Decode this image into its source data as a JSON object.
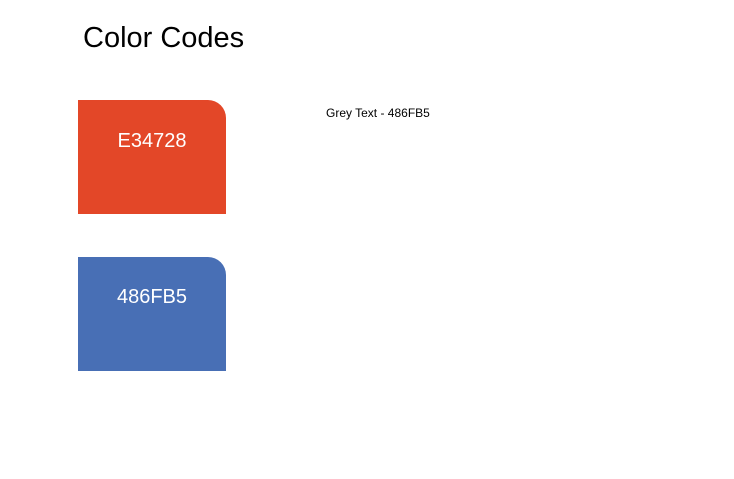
{
  "title": "Color Codes",
  "swatches": [
    {
      "label": "E34728",
      "color": "#E34728"
    },
    {
      "label": "486FB5",
      "color": "#486FB5"
    }
  ],
  "note": "Grey Text - 486FB5"
}
